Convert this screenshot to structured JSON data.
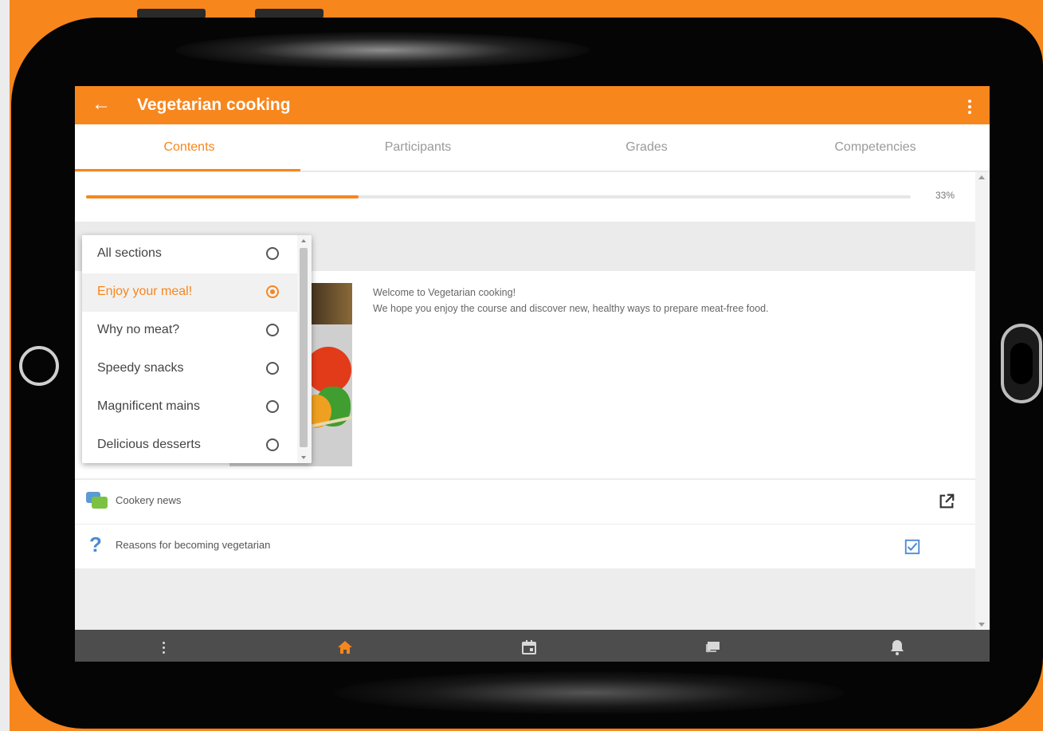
{
  "colors": {
    "accent": "#f7861d",
    "bottom_nav": "#4d4d4d",
    "forum_blue": "#5b9bd5",
    "forum_green": "#7cc242",
    "quiz_blue": "#4a8ad4"
  },
  "appbar": {
    "title": "Vegetarian cooking",
    "back_icon": "arrow-left-icon",
    "menu_icon": "more-vertical-icon"
  },
  "tabs": [
    {
      "label": "Contents",
      "active": true
    },
    {
      "label": "Participants",
      "active": false
    },
    {
      "label": "Grades",
      "active": false
    },
    {
      "label": "Competencies",
      "active": false
    }
  ],
  "progress": {
    "value": 0.33,
    "label": "33%"
  },
  "section_menu": {
    "items": [
      {
        "label": "All sections",
        "selected": false
      },
      {
        "label": "Enjoy your meal!",
        "selected": true
      },
      {
        "label": "Why no meat?",
        "selected": false
      },
      {
        "label": "Speedy snacks",
        "selected": false
      },
      {
        "label": "Magnificent mains",
        "selected": false
      },
      {
        "label": "Delicious desserts",
        "selected": false
      }
    ]
  },
  "summary": {
    "line1": "Welcome to Vegetarian cooking!",
    "line2": "We hope you enjoy the course and discover  new, healthy ways to prepare meat-free food."
  },
  "activities": [
    {
      "icon": "forum-icon",
      "label": "Cookery news",
      "action_icon": "open-external-icon"
    },
    {
      "icon": "quiz-icon",
      "glyph": "?",
      "label": "Reasons for becoming vegetarian",
      "action_icon": "checkbox-checked-icon"
    }
  ],
  "bottom_nav": [
    {
      "icon": "more-vertical-icon",
      "active": false
    },
    {
      "icon": "home-icon",
      "active": true
    },
    {
      "icon": "calendar-icon",
      "active": false
    },
    {
      "icon": "messages-icon",
      "active": false
    },
    {
      "icon": "bell-icon",
      "active": false
    }
  ]
}
